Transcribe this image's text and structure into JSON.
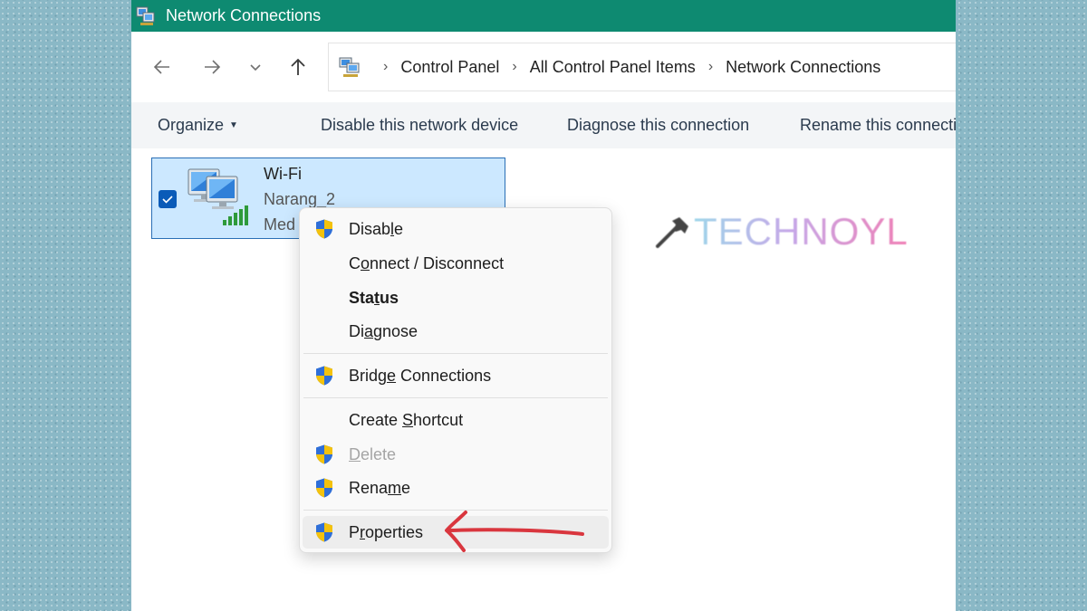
{
  "window": {
    "title": "Network Connections"
  },
  "address": {
    "crumbs": [
      "Control Panel",
      "All Control Panel Items",
      "Network Connections"
    ]
  },
  "commands": {
    "organize": "Organize",
    "disable_device": "Disable this network device",
    "diagnose": "Diagnose this connection",
    "rename": "Rename this connecti"
  },
  "connection": {
    "name": "Wi-Fi",
    "network": "Narang_2",
    "adapter_partial": "Med"
  },
  "watermark": {
    "text": "TECHNOYL"
  },
  "context_menu": {
    "items": [
      {
        "label": "Disable",
        "mnemonic_index": 5,
        "shield": true
      },
      {
        "label": "Connect / Disconnect",
        "mnemonic_index": 1,
        "shield": false
      },
      {
        "label": "Status",
        "mnemonic_index": 3,
        "shield": false,
        "bold": true
      },
      {
        "label": "Diagnose",
        "mnemonic_index": 2,
        "shield": false
      },
      {
        "label": "Bridge Connections",
        "mnemonic_index": 5,
        "shield": true
      },
      {
        "label": "Create Shortcut",
        "mnemonic_index": 7,
        "shield": false
      },
      {
        "label": "Delete",
        "mnemonic_index": 0,
        "shield": true,
        "disabled": true
      },
      {
        "label": "Rename",
        "mnemonic_index": 4,
        "shield": true
      },
      {
        "label": "Properties",
        "mnemonic_index": 1,
        "shield": true,
        "highlighted": true
      }
    ]
  },
  "colors": {
    "titlebar": "#0e8a71",
    "selection_fill": "#cce8ff",
    "selection_border": "#2a6fb5",
    "arrow": "#d9363e"
  }
}
